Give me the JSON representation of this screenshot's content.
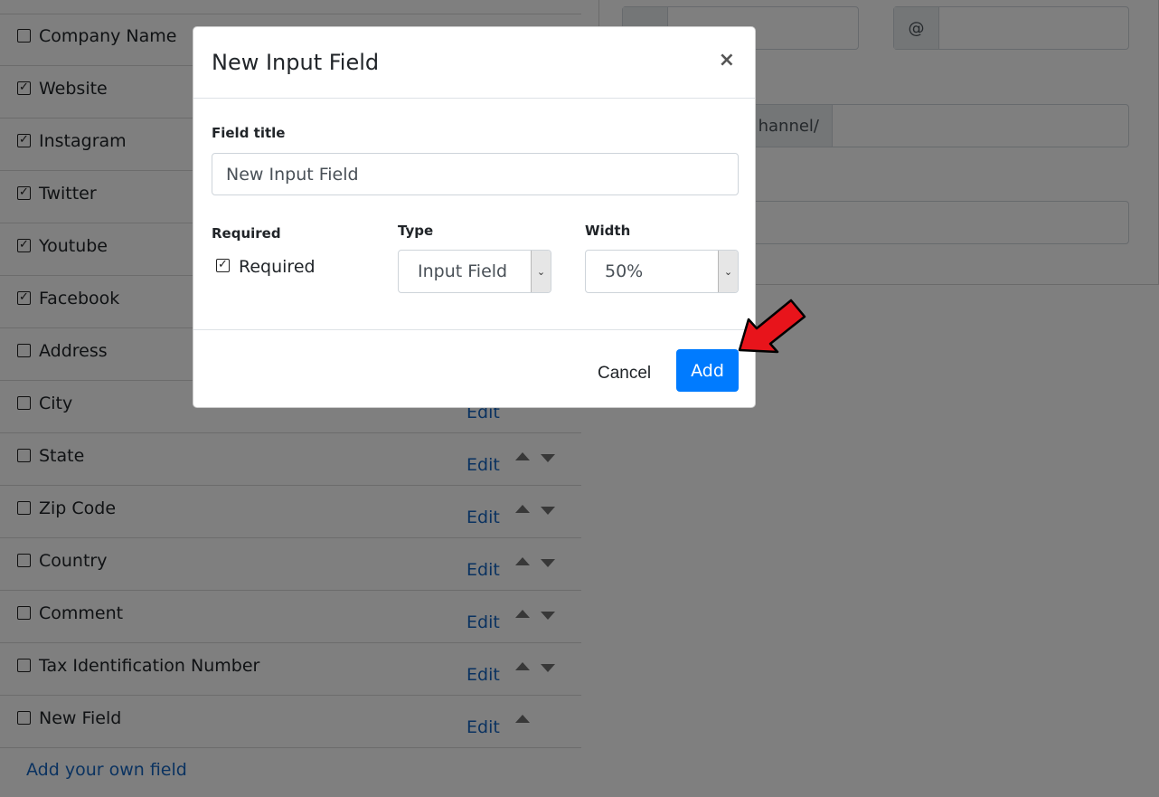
{
  "fields": [
    {
      "label": "Company Name",
      "checked": false,
      "edit": "",
      "up": false,
      "down": false
    },
    {
      "label": "Website",
      "checked": true,
      "edit": "",
      "up": false,
      "down": false
    },
    {
      "label": "Instagram",
      "checked": true,
      "edit": "",
      "up": false,
      "down": false
    },
    {
      "label": "Twitter",
      "checked": true,
      "edit": "",
      "up": false,
      "down": false
    },
    {
      "label": "Youtube",
      "checked": true,
      "edit": "",
      "up": false,
      "down": false
    },
    {
      "label": "Facebook",
      "checked": true,
      "edit": "",
      "up": false,
      "down": false
    },
    {
      "label": "Address",
      "checked": false,
      "edit": "",
      "up": false,
      "down": false
    },
    {
      "label": "City",
      "checked": false,
      "edit": "Edit",
      "up": false,
      "down": false
    },
    {
      "label": "State",
      "checked": false,
      "edit": "Edit",
      "up": true,
      "down": true
    },
    {
      "label": "Zip Code",
      "checked": false,
      "edit": "Edit",
      "up": true,
      "down": true
    },
    {
      "label": "Country",
      "checked": false,
      "edit": "Edit",
      "up": true,
      "down": true
    },
    {
      "label": "Comment",
      "checked": false,
      "edit": "Edit",
      "up": true,
      "down": true
    },
    {
      "label": "Tax Identification Number",
      "checked": false,
      "edit": "Edit",
      "up": true,
      "down": true
    },
    {
      "label": "New Field",
      "checked": false,
      "edit": "Edit",
      "up": true,
      "down": false
    }
  ],
  "add_own_field": "Add your own field",
  "right_card": {
    "at_addon": "@",
    "channel_addon": "hannel/"
  },
  "modal": {
    "title": "New Input Field",
    "close": "×",
    "field_title_label": "Field title",
    "field_title_value": "New Input Field",
    "required_label": "Required",
    "required_checkbox_text": "Required",
    "required_checked": true,
    "type_label": "Type",
    "type_value": "Input Field",
    "width_label": "Width",
    "width_value": "50%",
    "cancel_label": "Cancel",
    "add_label": "Add"
  },
  "colors": {
    "primary": "#007bff",
    "link": "#1565c0",
    "arrow": "#e8141b"
  },
  "icons": {
    "checkbox_checked": "☑",
    "select_chevron": "⌄"
  }
}
